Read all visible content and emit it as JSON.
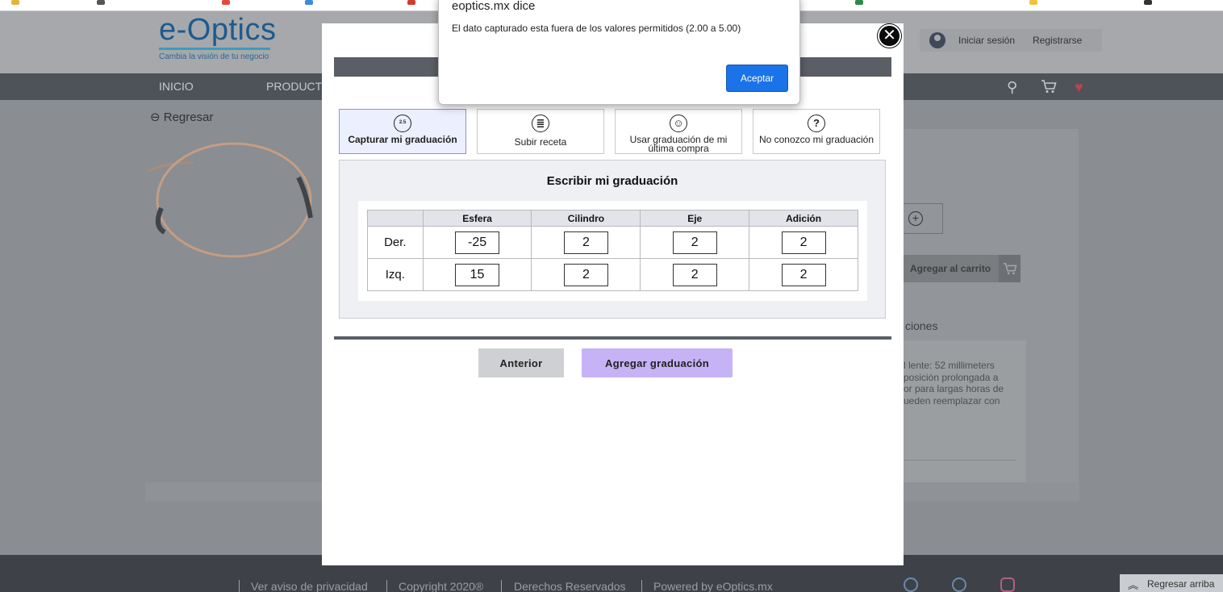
{
  "site": {
    "logo_text": "e-Optics",
    "logo_tagline": "Cambia la visión de tu negocio",
    "login_label": "Iniciar sesión",
    "register_label": "Registrarse"
  },
  "nav": {
    "items": [
      "INICIO",
      "PRODUCTO"
    ]
  },
  "page": {
    "back_label": "Regresar",
    "add_to_cart_label": "Agregar al carrito",
    "tab_fragment": "ciones",
    "description_lines": [
      "l lente: 52 millimeters",
      "posición prolongada a",
      "or para largas horas de",
      "ueden reemplazar con"
    ]
  },
  "modal": {
    "options": [
      {
        "label": "Capturar mi graduación",
        "icon": "prescription-value-icon",
        "icon_glyph": "2.5",
        "active": true
      },
      {
        "label": "Subir receta",
        "icon": "document-list-icon",
        "icon_glyph": "≣",
        "active": false
      },
      {
        "label": "Usar graduación de mi última compra",
        "icon": "user-icon",
        "icon_glyph": "☺",
        "active": false
      },
      {
        "label": "No conozco mi graduación",
        "icon": "question-icon",
        "icon_glyph": "?",
        "active": false
      }
    ],
    "section_title": "Escribir mi graduación",
    "table": {
      "columns": [
        "",
        "Esfera",
        "Cilindro",
        "Eje",
        "Adición"
      ],
      "rows": [
        {
          "label": "Der.",
          "esfera": "-25",
          "cilindro": "2",
          "eje": "2",
          "adicion": "2"
        },
        {
          "label": "Izq.",
          "esfera": "15",
          "cilindro": "2",
          "eje": "2",
          "adicion": "2"
        }
      ]
    },
    "prev_label": "Anterior",
    "add_label": "Agregar graduación",
    "close_glyph": "✕"
  },
  "alert": {
    "title": "eoptics.mx dice",
    "message": "El dato capturado esta fuera de los valores permitidos (2.00 a 5.00)",
    "ok_label": "Aceptar"
  },
  "footer": {
    "privacy": "Ver aviso de privacidad",
    "copyright": "Copyright 2020®",
    "rights": "Derechos Reservados",
    "powered": "Powered by eOptics.mx",
    "back_to_top": "Regresar arriba"
  },
  "colors": {
    "accent_button": "#c5b3f5",
    "alert_button": "#1a73e8",
    "navbar": "#4d5359",
    "logo": "#1d5a8e"
  }
}
